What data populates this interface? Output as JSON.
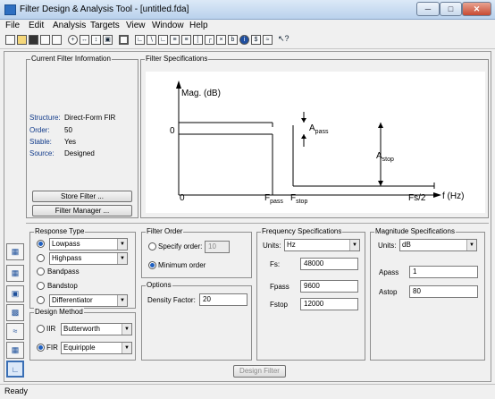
{
  "window": {
    "title": "Filter Design & Analysis Tool - [untitled.fda]"
  },
  "menu": [
    "File",
    "Edit",
    "Analysis",
    "Targets",
    "View",
    "Window",
    "Help"
  ],
  "current_info": {
    "title": "Current Filter Information",
    "rows": [
      {
        "label": "Structure:",
        "value": "Direct-Form FIR"
      },
      {
        "label": "Order:",
        "value": "50"
      },
      {
        "label": "Stable:",
        "value": "Yes"
      },
      {
        "label": "Source:",
        "value": "Designed"
      }
    ],
    "store_label": "Store Filter ...",
    "manager_label": "Filter Manager ..."
  },
  "specs_plot": {
    "title": "Filter Specifications",
    "mag_label": "Mag. (dB)",
    "zero_y": "0",
    "zero_x": "0",
    "xlabel": "f (Hz)",
    "fpass": "F",
    "fpass_sub": "pass",
    "fstop": "F",
    "fstop_sub": "stop",
    "fs2": "Fs/2",
    "apass": "A",
    "apass_sub": "pass",
    "astop": "A",
    "astop_sub": "stop"
  },
  "response_type": {
    "title": "Response Type",
    "items": [
      {
        "label": "Lowpass",
        "selected": true,
        "has_select": true
      },
      {
        "label": "Highpass",
        "selected": false,
        "has_select": true
      },
      {
        "label": "Bandpass",
        "selected": false,
        "has_select": false
      },
      {
        "label": "Bandstop",
        "selected": false,
        "has_select": false
      },
      {
        "label": "Differentiator",
        "selected": false,
        "has_select": true
      }
    ]
  },
  "design_method": {
    "title": "Design Method",
    "iir_label": "IIR",
    "iir_value": "Butterworth",
    "fir_label": "FIR",
    "fir_value": "Equiripple"
  },
  "filter_order": {
    "title": "Filter Order",
    "specify_label": "Specify order:",
    "specify_value": "10",
    "minimum_label": "Minimum order"
  },
  "options": {
    "title": "Options",
    "density_label": "Density Factor:",
    "density_value": "20"
  },
  "freq_specs": {
    "title": "Frequency Specifications",
    "units_label": "Units:",
    "units_value": "Hz",
    "fs_label": "Fs:",
    "fs_value": "48000",
    "fpass_label": "Fpass",
    "fpass_value": "9600",
    "fstop_label": "Fstop",
    "fstop_value": "12000"
  },
  "mag_specs": {
    "title": "Magnitude Specifications",
    "units_label": "Units:",
    "units_value": "dB",
    "apass_label": "Apass",
    "apass_value": "1",
    "astop_label": "Astop",
    "astop_value": "80"
  },
  "design_button": "Design Filter",
  "status": "Ready"
}
